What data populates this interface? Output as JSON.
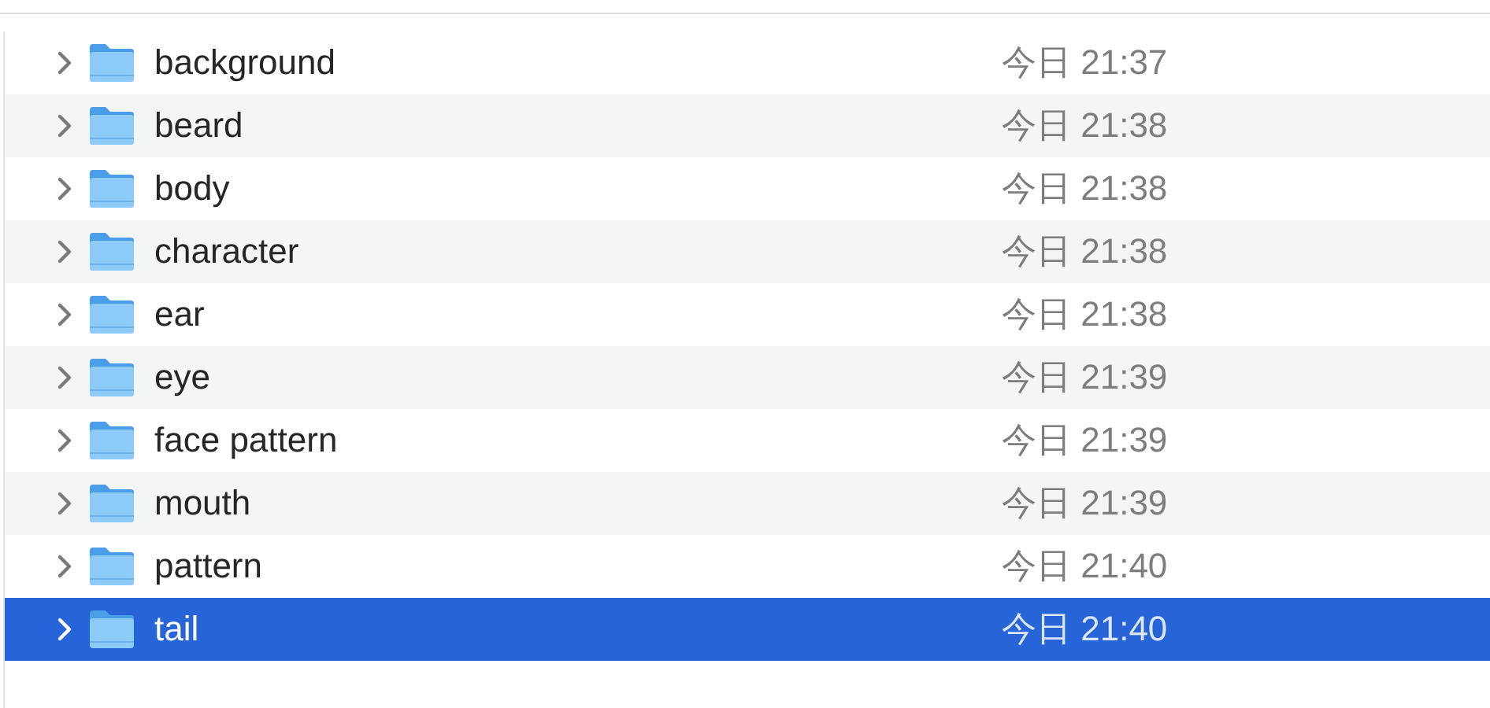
{
  "rows": [
    {
      "name": "background",
      "date": "今日 21:37",
      "selected": false
    },
    {
      "name": "beard",
      "date": "今日 21:38",
      "selected": false
    },
    {
      "name": "body",
      "date": "今日 21:38",
      "selected": false
    },
    {
      "name": "character",
      "date": "今日 21:38",
      "selected": false
    },
    {
      "name": "ear",
      "date": "今日 21:38",
      "selected": false
    },
    {
      "name": "eye",
      "date": "今日 21:39",
      "selected": false
    },
    {
      "name": "face pattern",
      "date": "今日 21:39",
      "selected": false
    },
    {
      "name": "mouth",
      "date": "今日 21:39",
      "selected": false
    },
    {
      "name": "pattern",
      "date": "今日 21:40",
      "selected": false
    },
    {
      "name": "tail",
      "date": "今日 21:40",
      "selected": true
    }
  ]
}
